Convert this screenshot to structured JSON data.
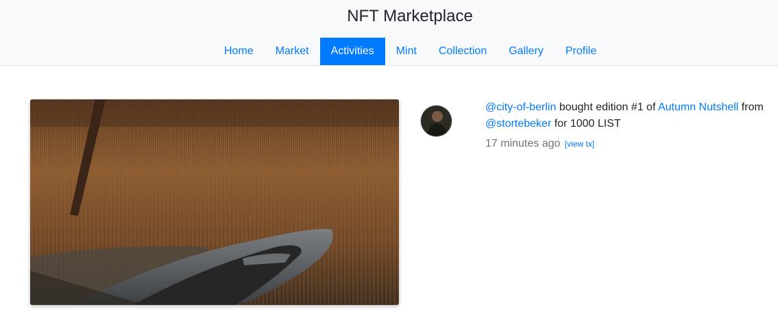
{
  "header": {
    "title": "NFT Marketplace"
  },
  "nav": {
    "items": [
      {
        "label": "Home",
        "active": false
      },
      {
        "label": "Market",
        "active": false
      },
      {
        "label": "Activities",
        "active": true
      },
      {
        "label": "Mint",
        "active": false
      },
      {
        "label": "Collection",
        "active": false
      },
      {
        "label": "Gallery",
        "active": false
      },
      {
        "label": "Profile",
        "active": false
      }
    ]
  },
  "activity": {
    "buyer": "@city-of-berlin",
    "action": "bought edition #1 of",
    "artwork": "Autumn Nutshell",
    "from_word": "from",
    "seller": "@stortebeker",
    "price_text": "for 1000 LIST",
    "time_ago": "17 minutes ago",
    "view_tx_label": "[view tx]"
  },
  "colors": {
    "accent": "#007bff",
    "header_bg": "#f8f9fa",
    "muted_text": "#6c757d"
  }
}
